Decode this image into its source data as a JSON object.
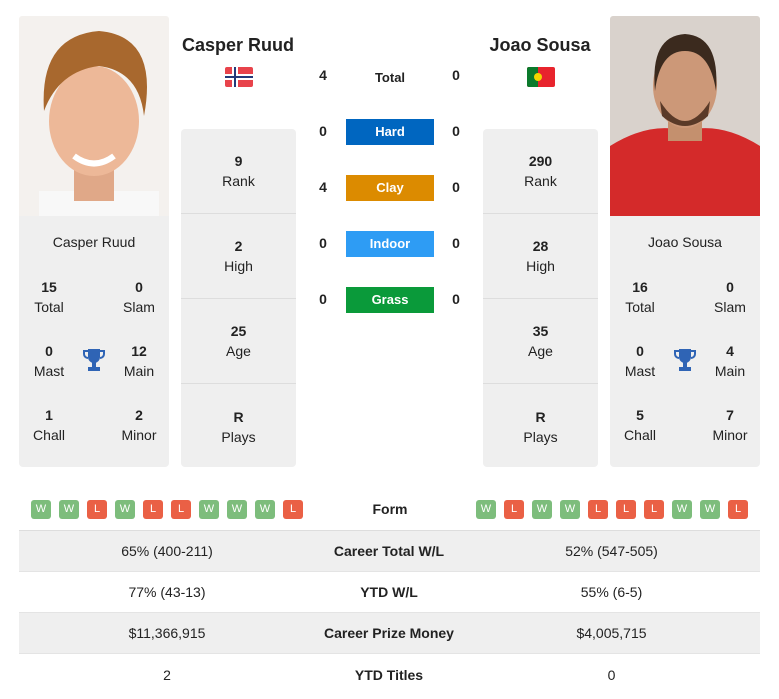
{
  "p1": {
    "name": "Casper Ruud",
    "flag": "norway-flag",
    "rank": "9",
    "rank_label": "Rank",
    "high": "2",
    "high_label": "High",
    "age": "25",
    "age_label": "Age",
    "plays": "R",
    "plays_label": "Plays",
    "total": "15",
    "total_label": "Total",
    "slam": "0",
    "slam_label": "Slam",
    "mast": "0",
    "mast_label": "Mast",
    "main": "12",
    "main_label": "Main",
    "chall": "1",
    "chall_label": "Chall",
    "minor": "2",
    "minor_label": "Minor",
    "form": [
      "W",
      "W",
      "L",
      "W",
      "L",
      "L",
      "W",
      "W",
      "W",
      "L"
    ]
  },
  "p2": {
    "name": "Joao Sousa",
    "flag": "portugal-flag",
    "rank": "290",
    "rank_label": "Rank",
    "high": "28",
    "high_label": "High",
    "age": "35",
    "age_label": "Age",
    "plays": "R",
    "plays_label": "Plays",
    "total": "16",
    "total_label": "Total",
    "slam": "0",
    "slam_label": "Slam",
    "mast": "0",
    "mast_label": "Mast",
    "main": "4",
    "main_label": "Main",
    "chall": "5",
    "chall_label": "Chall",
    "minor": "7",
    "minor_label": "Minor",
    "form": [
      "W",
      "L",
      "W",
      "W",
      "L",
      "L",
      "L",
      "W",
      "W",
      "L"
    ]
  },
  "h2h": [
    {
      "label": "Total",
      "p1": "4",
      "p2": "0",
      "color": ""
    },
    {
      "label": "Hard",
      "p1": "0",
      "p2": "0",
      "color": "#0066c0"
    },
    {
      "label": "Clay",
      "p1": "4",
      "p2": "0",
      "color": "#dc8b00"
    },
    {
      "label": "Indoor",
      "p1": "0",
      "p2": "0",
      "color": "#2e9cf4"
    },
    {
      "label": "Grass",
      "p1": "0",
      "p2": "0",
      "color": "#0a9a3a"
    }
  ],
  "form_label": "Form",
  "colors": {
    "win": "#7dbd7c",
    "loss": "#ea6045"
  },
  "table": [
    {
      "p1": "65% (400-211)",
      "label": "Career Total W/L",
      "p2": "52% (547-505)"
    },
    {
      "p1": "77% (43-13)",
      "label": "YTD W/L",
      "p2": "55% (6-5)"
    },
    {
      "p1": "$11,366,915",
      "label": "Career Prize Money",
      "p2": "$4,005,715"
    },
    {
      "p1": "2",
      "label": "YTD Titles",
      "p2": "0"
    }
  ]
}
